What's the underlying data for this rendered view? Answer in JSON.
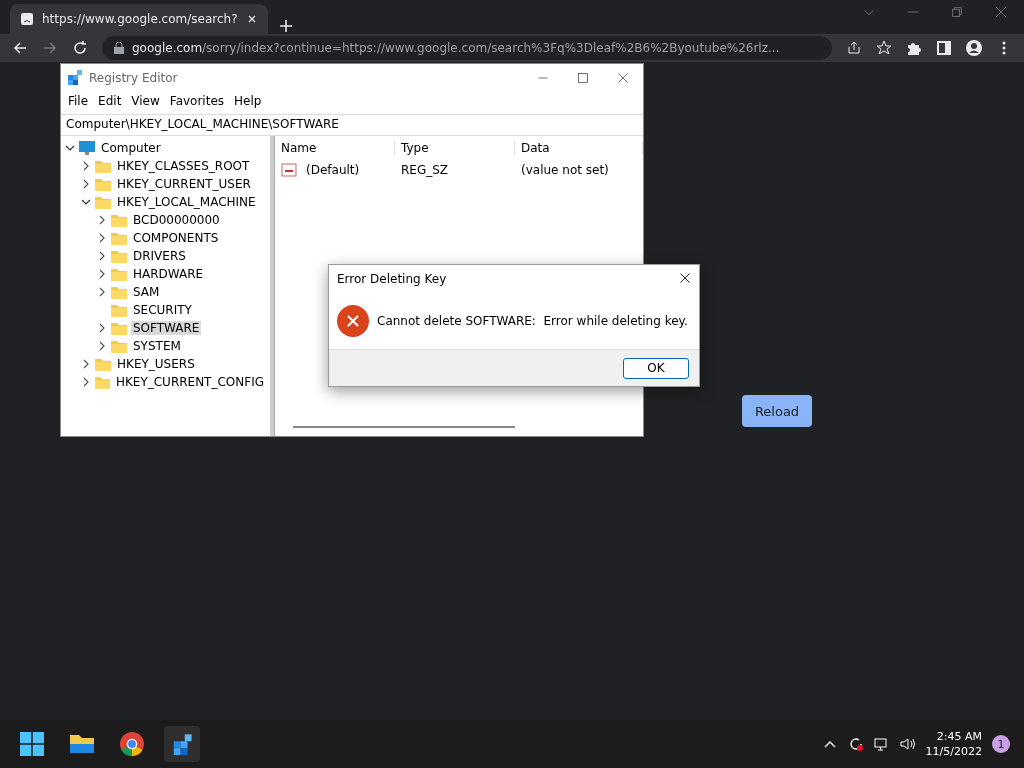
{
  "browser": {
    "tab": {
      "title": "https://www.google.com/search?"
    },
    "address": {
      "host": "google.com",
      "path": "/sorry/index?continue=https://www.google.com/search%3Fq%3Dleaf%2B6%2Byoutube%26rlz..."
    },
    "reload_button": "Reload"
  },
  "regedit": {
    "title": "Registry Editor",
    "menu": [
      "File",
      "Edit",
      "View",
      "Favorites",
      "Help"
    ],
    "path": "Computer\\HKEY_LOCAL_MACHINE\\SOFTWARE",
    "tree": [
      {
        "label": "Computer",
        "kind": "computer",
        "expandable": true,
        "expanded": true,
        "selected": false,
        "children": [
          {
            "label": "HKEY_CLASSES_ROOT",
            "kind": "folder",
            "expandable": true,
            "expanded": false,
            "selected": false
          },
          {
            "label": "HKEY_CURRENT_USER",
            "kind": "folder",
            "expandable": true,
            "expanded": false,
            "selected": false
          },
          {
            "label": "HKEY_LOCAL_MACHINE",
            "kind": "folder",
            "expandable": true,
            "expanded": true,
            "selected": false,
            "children": [
              {
                "label": "BCD00000000",
                "kind": "folder",
                "expandable": true,
                "expanded": false,
                "selected": false
              },
              {
                "label": "COMPONENTS",
                "kind": "folder",
                "expandable": true,
                "expanded": false,
                "selected": false
              },
              {
                "label": "DRIVERS",
                "kind": "folder",
                "expandable": true,
                "expanded": false,
                "selected": false
              },
              {
                "label": "HARDWARE",
                "kind": "folder",
                "expandable": true,
                "expanded": false,
                "selected": false
              },
              {
                "label": "SAM",
                "kind": "folder",
                "expandable": true,
                "expanded": false,
                "selected": false
              },
              {
                "label": "SECURITY",
                "kind": "folder",
                "expandable": false,
                "expanded": false,
                "selected": false
              },
              {
                "label": "SOFTWARE",
                "kind": "folder",
                "expandable": true,
                "expanded": false,
                "selected": true
              },
              {
                "label": "SYSTEM",
                "kind": "folder",
                "expandable": true,
                "expanded": false,
                "selected": false
              }
            ]
          },
          {
            "label": "HKEY_USERS",
            "kind": "folder",
            "expandable": true,
            "expanded": false,
            "selected": false
          },
          {
            "label": "HKEY_CURRENT_CONFIG",
            "kind": "folder",
            "expandable": true,
            "expanded": false,
            "selected": false
          }
        ]
      }
    ],
    "columns": [
      "Name",
      "Type",
      "Data"
    ],
    "rows": [
      {
        "name": "(Default)",
        "type": "REG_SZ",
        "data": "(value not set)"
      }
    ]
  },
  "dialog": {
    "title": "Error Deleting Key",
    "message": "Cannot delete SOFTWARE:  Error while deleting key.",
    "button": "OK"
  },
  "taskbar": {
    "time": "2:45 AM",
    "date": "11/5/2022",
    "notifications": "1"
  }
}
